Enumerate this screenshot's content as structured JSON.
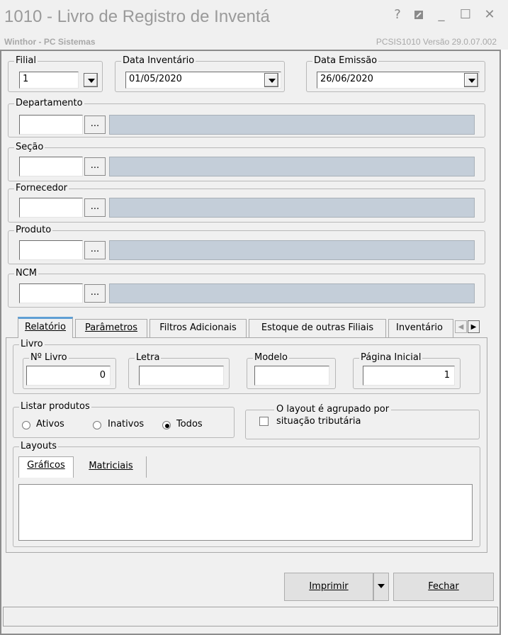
{
  "window": {
    "title": "1010 - Livro de Registro de Inventá",
    "subtitle": "Winthor - PC Sistemas",
    "version": "PCSIS1010  Versão  29.0.07.002",
    "help_glyph": "?",
    "minimize_glyph": "_",
    "maximize_glyph": "☐",
    "close_glyph": "✕"
  },
  "filial": {
    "label": "Filial",
    "value": "1"
  },
  "data_inventario": {
    "label": "Data Inventário",
    "value": "01/05/2020"
  },
  "data_emissao": {
    "label": "Data Emissão",
    "value": "26/06/2020"
  },
  "lookups": [
    {
      "label": "Departamento",
      "code": "",
      "description": "",
      "button": "..."
    },
    {
      "label": "Seção",
      "code": "",
      "description": "",
      "button": "..."
    },
    {
      "label": "Fornecedor",
      "code": "",
      "description": "",
      "button": "..."
    },
    {
      "label": "Produto",
      "code": "",
      "description": "",
      "button": "..."
    },
    {
      "label": "NCM",
      "code": "",
      "description": "",
      "button": "..."
    }
  ],
  "tabs": [
    {
      "label": "Relatório",
      "active": true
    },
    {
      "label": "Parâmetros",
      "active": false
    },
    {
      "label": "Filtros Adicionais",
      "active": false
    },
    {
      "label": "Estoque de outras Filiais",
      "active": false
    },
    {
      "label": "Inventário",
      "active": false
    }
  ],
  "tab_scroll": {
    "left": "◀",
    "right": "▶"
  },
  "livro": {
    "label": "Livro",
    "numero": {
      "label": "Nº Livro",
      "value": "0"
    },
    "letra": {
      "label": "Letra",
      "value": ""
    },
    "modelo": {
      "label": "Modelo",
      "value": ""
    },
    "pagina_inicial": {
      "label": "Página Inicial",
      "value": "1"
    }
  },
  "listar_produtos": {
    "label": "Listar produtos",
    "options": [
      {
        "label": "Ativos",
        "checked": false
      },
      {
        "label": "Inativos",
        "checked": false
      },
      {
        "label": "Todos",
        "checked": true
      }
    ]
  },
  "agrupado": {
    "line1": "O layout é agrupado por",
    "line2": "situação tributária",
    "checked": false
  },
  "layouts": {
    "label": "Layouts",
    "tabs": [
      {
        "label": "Gráficos",
        "active": true
      },
      {
        "label": "Matriciais",
        "active": false
      }
    ]
  },
  "buttons": {
    "imprimir": "Imprimir",
    "fechar": "Fechar"
  }
}
